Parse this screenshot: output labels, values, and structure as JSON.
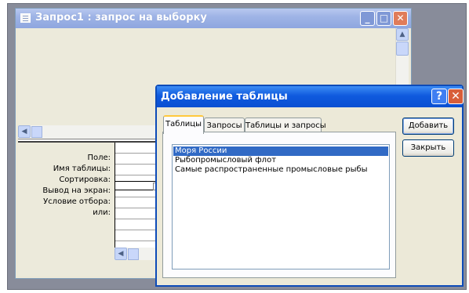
{
  "query_window": {
    "title": "Запрос1 : запрос на выборку",
    "min_glyph": "_",
    "max_glyph": "□",
    "close_glyph": "✕"
  },
  "grid": {
    "row_labels": [
      "Поле:",
      "Имя таблицы:",
      "Сортировка:",
      "Вывод на экран:",
      "Условие отбора:",
      "или:"
    ]
  },
  "dialog": {
    "title": "Добавление таблицы",
    "help_glyph": "?",
    "close_glyph": "✕",
    "tabs": [
      "Таблицы",
      "Запросы",
      "Таблицы и запросы"
    ],
    "active_tab": "Таблицы",
    "list": [
      "Моря России",
      "Рыбопромысловый флот",
      "Самые распространенные промысловые рыбы"
    ],
    "selected_item": "Моря России",
    "add_button": "Добавить",
    "close_button": "Закрыть"
  },
  "colors": {
    "dialog_title": "#0a4fd2",
    "query_title": "#9fb4e6",
    "selection": "#316ac5",
    "background": "#888c9a"
  }
}
